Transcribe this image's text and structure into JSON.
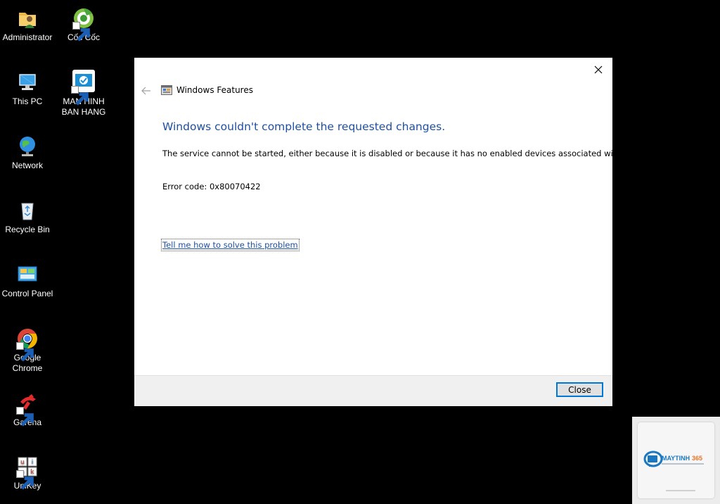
{
  "desktop": {
    "background_color": "#000000",
    "icons": [
      {
        "label": "Administrator",
        "icon": "user-folder-icon"
      },
      {
        "label": "Cốc Cốc",
        "icon": "coccoc-browser-icon"
      },
      {
        "label": "This PC",
        "icon": "computer-icon"
      },
      {
        "label": "MAN HINH BAN HANG",
        "icon": "sales-app-icon"
      },
      {
        "label": "Network",
        "icon": "network-globe-icon"
      },
      {
        "label": "Recycle Bin",
        "icon": "recycle-bin-icon"
      },
      {
        "label": "Control Panel",
        "icon": "control-panel-icon"
      },
      {
        "label": "Google Chrome",
        "icon": "chrome-icon"
      },
      {
        "label": "Garena",
        "icon": "garena-icon"
      },
      {
        "label": "UniKey",
        "icon": "unikey-icon"
      }
    ]
  },
  "dialog": {
    "title": "Windows Features",
    "main_instruction": "Windows couldn't complete the requested changes.",
    "content": "The service cannot be started, either because it is disabled or because it has no enabled devices associated with it.",
    "error_code": "Error code: 0x80070422",
    "help_link": "Tell me how to solve this problem",
    "close_button": "Close",
    "accent_color": "#1f4fa3"
  },
  "watermark": {
    "brand": "MAYTINH365"
  }
}
